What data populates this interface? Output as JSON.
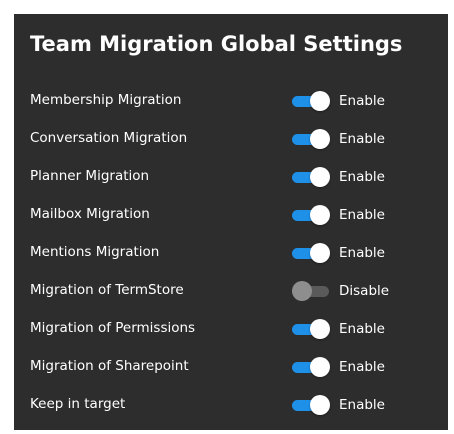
{
  "title": "Team Migration Global Settings",
  "colors": {
    "panel_background": "#2d2d2d",
    "toggle_on": "#1e90e8",
    "toggle_off_track": "#5a5a5a",
    "toggle_off_thumb": "#8e8e8e",
    "text": "#ffffff"
  },
  "settings": [
    {
      "label": "Membership Migration",
      "enabled": true,
      "state_text": "Enable"
    },
    {
      "label": "Conversation Migration",
      "enabled": true,
      "state_text": "Enable"
    },
    {
      "label": "Planner Migration",
      "enabled": true,
      "state_text": "Enable"
    },
    {
      "label": "Mailbox Migration",
      "enabled": true,
      "state_text": "Enable"
    },
    {
      "label": "Mentions Migration",
      "enabled": true,
      "state_text": "Enable"
    },
    {
      "label": "Migration of TermStore",
      "enabled": false,
      "state_text": "Disable"
    },
    {
      "label": "Migration of Permissions",
      "enabled": true,
      "state_text": "Enable"
    },
    {
      "label": "Migration of Sharepoint",
      "enabled": true,
      "state_text": "Enable"
    },
    {
      "label": "Keep in target",
      "enabled": true,
      "state_text": "Enable"
    }
  ]
}
